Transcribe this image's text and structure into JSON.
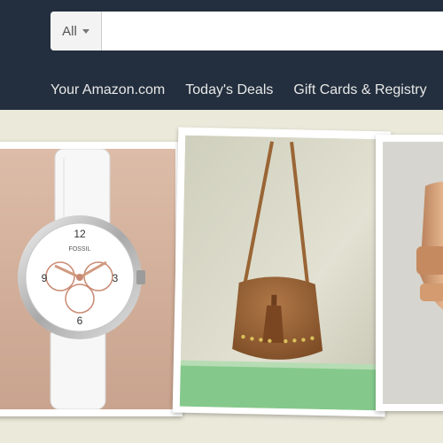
{
  "search": {
    "department_label": "All",
    "placeholder": ""
  },
  "nav": {
    "items": [
      {
        "label": "Your Amazon.com"
      },
      {
        "label": "Today's Deals"
      },
      {
        "label": "Gift Cards & Registry"
      }
    ]
  },
  "products": [
    {
      "name": "watch",
      "brand_mark": "FOSSIL"
    },
    {
      "name": "bag"
    },
    {
      "name": "sandal"
    }
  ],
  "colors": {
    "header_bg": "#232f3e",
    "page_bg": "#ebe9d9",
    "nav_text": "#e8e8e8"
  },
  "icons": [
    "chevron-down-icon"
  ]
}
